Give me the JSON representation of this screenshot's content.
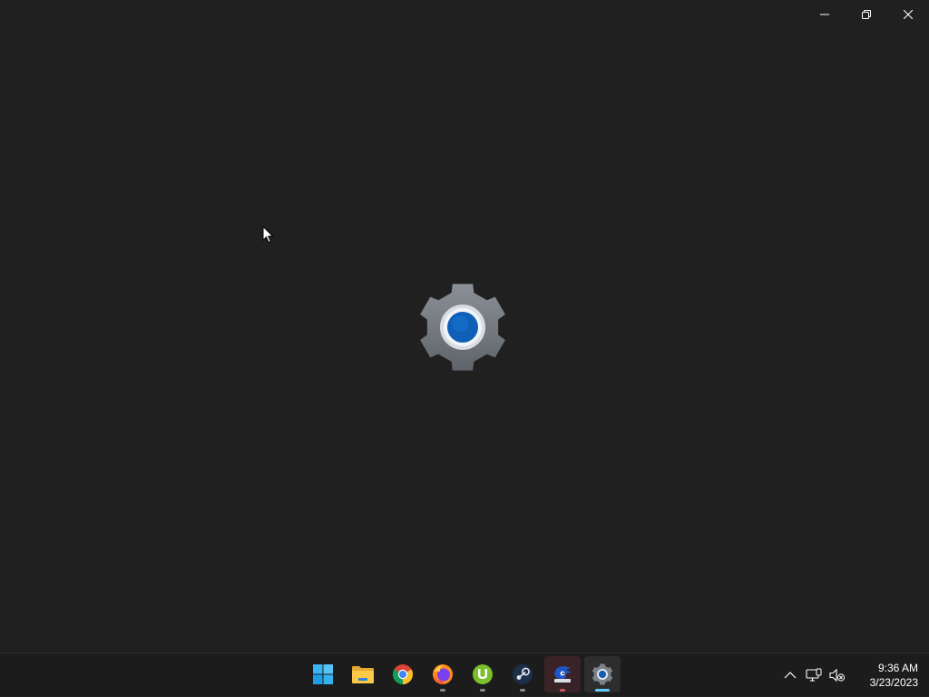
{
  "app": {
    "name": "Settings"
  },
  "window_controls": {
    "minimize_icon": "minimize-icon",
    "restore_icon": "restore-icon",
    "close_icon": "close-icon"
  },
  "splash": {
    "icon": "settings-gear-icon",
    "accent": "#0f5fb6"
  },
  "taskbar": {
    "apps": [
      {
        "name": "Start",
        "icon": "windows-start-icon"
      },
      {
        "name": "File Explorer",
        "icon": "folder-icon"
      },
      {
        "name": "Google Chrome",
        "icon": "chrome-icon"
      },
      {
        "name": "Firefox",
        "icon": "firefox-icon",
        "running": true
      },
      {
        "name": "uTorrent",
        "icon": "utorrent-icon",
        "running": true
      },
      {
        "name": "Steam",
        "icon": "steam-icon",
        "running": true
      },
      {
        "name": "Sonic",
        "icon": "sonic-game-icon",
        "running": true
      },
      {
        "name": "Settings",
        "icon": "settings-icon",
        "focused": true
      }
    ],
    "tray": {
      "overflow_icon": "chevron-up-icon",
      "network_icon": "network-icon",
      "volume_icon": "volume-muted-icon"
    },
    "clock": {
      "time": "9:36 AM",
      "date": "3/23/2023"
    }
  },
  "colors": {
    "background": "#202020",
    "taskbar": "#1c1c1c",
    "focus_indicator": "#60cdff"
  }
}
